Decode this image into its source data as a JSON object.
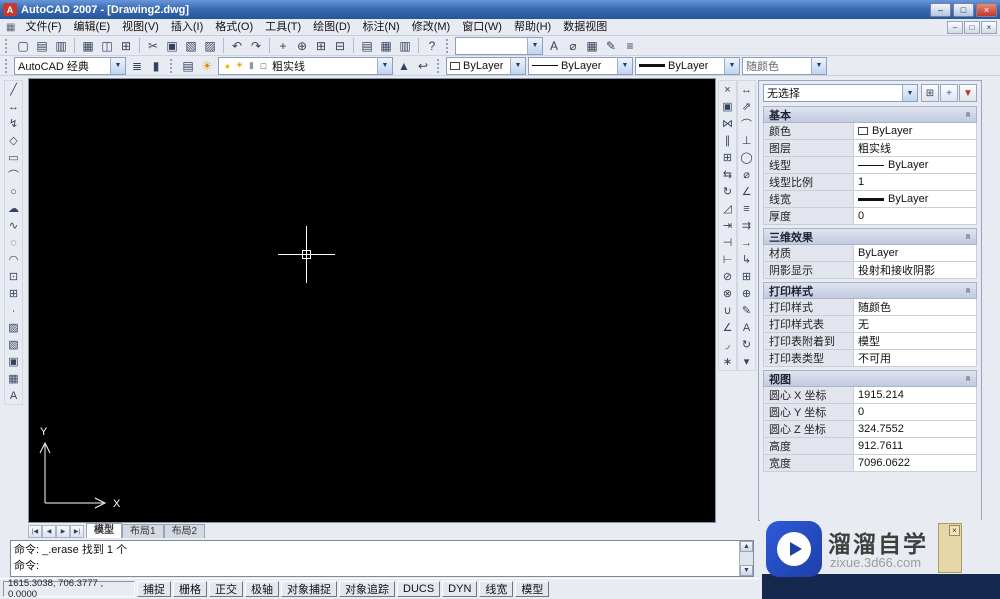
{
  "window": {
    "title": "AutoCAD 2007 - [Drawing2.dwg]",
    "controls": {
      "minimize": "–",
      "maximize": "□",
      "close": "×"
    }
  },
  "menubar": {
    "items": [
      "文件(F)",
      "编辑(E)",
      "视图(V)",
      "插入(I)",
      "格式(O)",
      "工具(T)",
      "绘图(D)",
      "标注(N)",
      "修改(M)",
      "窗口(W)",
      "帮助(H)",
      "数据视图"
    ]
  },
  "toolbars": {
    "workspace": "AutoCAD 经典",
    "layer": "粗实线",
    "color": "ByLayer",
    "linetype": "ByLayer",
    "lineweight": "ByLayer",
    "plot_style": "随颜色",
    "style_combo_value": "",
    "standard_icons": [
      {
        "n": "new-file",
        "g": "▢"
      },
      {
        "n": "open-file",
        "g": "▤"
      },
      {
        "n": "save-file",
        "g": "▥"
      },
      {
        "sep": 1
      },
      {
        "n": "plot",
        "g": "▦"
      },
      {
        "n": "plot-preview",
        "g": "◫"
      },
      {
        "n": "publish",
        "g": "⊞"
      },
      {
        "sep": 1
      },
      {
        "n": "cut",
        "g": "✂"
      },
      {
        "n": "copy-clip",
        "g": "▣"
      },
      {
        "n": "paste",
        "g": "▧"
      },
      {
        "n": "match-properties",
        "g": "▨"
      },
      {
        "sep": 1
      },
      {
        "n": "undo",
        "g": "↶"
      },
      {
        "n": "redo",
        "g": "↷"
      },
      {
        "sep": 1
      },
      {
        "n": "pan-realtime",
        "g": "+"
      },
      {
        "n": "zoom-realtime",
        "g": "⊕"
      },
      {
        "n": "zoom-window",
        "g": "⊞"
      },
      {
        "n": "zoom-previous",
        "g": "⊟"
      },
      {
        "sep": 1
      },
      {
        "n": "properties",
        "g": "▤"
      },
      {
        "n": "designcenter",
        "g": "▦"
      },
      {
        "n": "tool-palettes",
        "g": "▥"
      },
      {
        "sep": 1
      },
      {
        "n": "help",
        "g": "?"
      }
    ],
    "style_icons": [
      {
        "n": "text-style",
        "g": "A"
      },
      {
        "n": "dimension-style",
        "g": "⌀"
      },
      {
        "n": "table-style",
        "g": "▦"
      },
      {
        "n": "sketch",
        "g": "✎"
      },
      {
        "n": "list",
        "g": "≡"
      }
    ],
    "workspace_icons": [
      {
        "n": "workspace-settings",
        "g": "≣"
      },
      {
        "n": "workspace-lock",
        "g": "▮"
      }
    ],
    "layer_pre_icons": [
      {
        "n": "layer-properties-manager",
        "g": "▤"
      },
      {
        "n": "layer-states",
        "g": "☀",
        "c": "#d89000"
      }
    ],
    "layer_combo_icons": [
      {
        "n": "layer-on",
        "g": "●",
        "c": "#e6c500"
      },
      {
        "n": "layer-freeze",
        "g": "☀",
        "c": "#e09000"
      },
      {
        "n": "layer-lock",
        "g": "▮",
        "c": "#8a96ac"
      },
      {
        "n": "layer-color",
        "g": "□",
        "c": "#333333"
      }
    ],
    "layer_post_icons": [
      {
        "n": "make-object-layer-current",
        "g": "▲"
      },
      {
        "n": "layer-previous",
        "g": "↩"
      }
    ],
    "draw_icons": [
      {
        "n": "line",
        "g": "╱"
      },
      {
        "n": "construction-line",
        "g": "↔"
      },
      {
        "n": "polyline",
        "g": "↯"
      },
      {
        "n": "polygon",
        "g": "◇"
      },
      {
        "n": "rectangle",
        "g": "▭"
      },
      {
        "n": "arc",
        "g": "⌒"
      },
      {
        "n": "circle",
        "g": "○"
      },
      {
        "n": "revision-cloud",
        "g": "☁"
      },
      {
        "n": "spline",
        "g": "∿"
      },
      {
        "n": "ellipse",
        "g": "◌"
      },
      {
        "n": "ellipse-arc",
        "g": "◠"
      },
      {
        "n": "insert-block",
        "g": "⊡"
      },
      {
        "n": "make-block",
        "g": "⊞"
      },
      {
        "n": "point",
        "g": "∙"
      },
      {
        "n": "hatch",
        "g": "▨"
      },
      {
        "n": "gradient",
        "g": "▧"
      },
      {
        "n": "region",
        "g": "▣"
      },
      {
        "n": "table",
        "g": "▦"
      },
      {
        "n": "multiline-text",
        "g": "A"
      }
    ],
    "modify_icons": [
      {
        "n": "erase",
        "g": "×"
      },
      {
        "n": "copy",
        "g": "▣"
      },
      {
        "n": "mirror",
        "g": "⋈"
      },
      {
        "n": "offset",
        "g": "∥"
      },
      {
        "n": "array",
        "g": "⊞"
      },
      {
        "n": "move",
        "g": "⇆"
      },
      {
        "n": "rotate",
        "g": "↻"
      },
      {
        "n": "scale",
        "g": "◿"
      },
      {
        "n": "stretch",
        "g": "⇥"
      },
      {
        "n": "trim",
        "g": "⊣"
      },
      {
        "n": "extend",
        "g": "⊢"
      },
      {
        "n": "break-at-point",
        "g": "⊘"
      },
      {
        "n": "break",
        "g": "⊗"
      },
      {
        "n": "join",
        "g": "∪"
      },
      {
        "n": "chamfer",
        "g": "∠"
      },
      {
        "n": "fillet",
        "g": "◞"
      },
      {
        "n": "explode",
        "g": "∗"
      }
    ],
    "dimension_icons": [
      {
        "n": "linear-dimension",
        "g": "↔"
      },
      {
        "n": "aligned-dimension",
        "g": "⇗"
      },
      {
        "n": "arc-length-dimension",
        "g": "⌒"
      },
      {
        "n": "ordinate-dimension",
        "g": "⊥"
      },
      {
        "n": "radius-dimension",
        "g": "◯"
      },
      {
        "n": "diameter-dimension",
        "g": "⌀"
      },
      {
        "n": "angular-dimension",
        "g": "∠"
      },
      {
        "n": "quick-dimension",
        "g": "≡"
      },
      {
        "n": "baseline-dimension",
        "g": "⇉"
      },
      {
        "n": "continue-dimension",
        "g": "→"
      },
      {
        "n": "quick-leader",
        "g": "↳"
      },
      {
        "n": "tolerance",
        "g": "⊞"
      },
      {
        "n": "center-mark",
        "g": "⊕"
      },
      {
        "n": "dimension-edit",
        "g": "✎"
      },
      {
        "n": "dimension-text-edit",
        "g": "A"
      },
      {
        "n": "dimension-update",
        "g": "↻"
      },
      {
        "n": "dimension-style-control",
        "g": "▾"
      }
    ]
  },
  "properties_palette": {
    "selection": "无选择",
    "buttons": [
      {
        "n": "toggle-pickadd",
        "g": "⊞"
      },
      {
        "n": "select-objects",
        "g": "+",
        "c": "#2a58c8"
      },
      {
        "n": "quick-select",
        "g": "▼",
        "c": "#c03030"
      }
    ],
    "sections": [
      {
        "title": "基本",
        "rows": [
          {
            "label": "颜色",
            "value": "ByLayer",
            "swatch": "color"
          },
          {
            "label": "图层",
            "value": "粗实线"
          },
          {
            "label": "线型",
            "value": "ByLayer",
            "swatch": "line"
          },
          {
            "label": "线型比例",
            "value": "1"
          },
          {
            "label": "线宽",
            "value": "ByLayer",
            "swatch": "lineweight"
          },
          {
            "label": "厚度",
            "value": "0"
          }
        ]
      },
      {
        "title": "三维效果",
        "rows": [
          {
            "label": "材质",
            "value": "ByLayer"
          },
          {
            "label": "阴影显示",
            "value": "投射和接收阴影"
          }
        ]
      },
      {
        "title": "打印样式",
        "rows": [
          {
            "label": "打印样式",
            "value": "随颜色"
          },
          {
            "label": "打印样式表",
            "value": "无"
          },
          {
            "label": "打印表附着到",
            "value": "模型"
          },
          {
            "label": "打印表类型",
            "value": "不可用"
          }
        ]
      },
      {
        "title": "视图",
        "rows": [
          {
            "label": "圆心 X 坐标",
            "value": "1915.214"
          },
          {
            "label": "圆心 Y 坐标",
            "value": "0"
          },
          {
            "label": "圆心 Z 坐标",
            "value": "324.7552"
          },
          {
            "label": "高度",
            "value": "912.7611"
          },
          {
            "label": "宽度",
            "value": "7096.0622"
          }
        ]
      }
    ]
  },
  "tabs": {
    "nav": [
      "|◀",
      "◀",
      "▶",
      "▶|"
    ],
    "items": [
      "模型",
      "布局1",
      "布局2"
    ],
    "active": "模型"
  },
  "command": {
    "lines": [
      "命令: _.erase 找到 1 个",
      "命令:"
    ]
  },
  "statusbar": {
    "coords": "1615.3038, 706.3777 , 0.0000",
    "toggles": [
      "捕捉",
      "栅格",
      "正交",
      "极轴",
      "对象捕捉",
      "对象追踪",
      "DUCS",
      "DYN",
      "线宽",
      "模型"
    ]
  },
  "ucs": {
    "x_label": "X",
    "y_label": "Y"
  },
  "watermark": {
    "title": "溜溜自学",
    "url": "zixue.3d66.com"
  },
  "colors": {
    "accent_navy": "#15294e",
    "logo_blue": "#1d3fa8",
    "canvas": "#000000"
  }
}
